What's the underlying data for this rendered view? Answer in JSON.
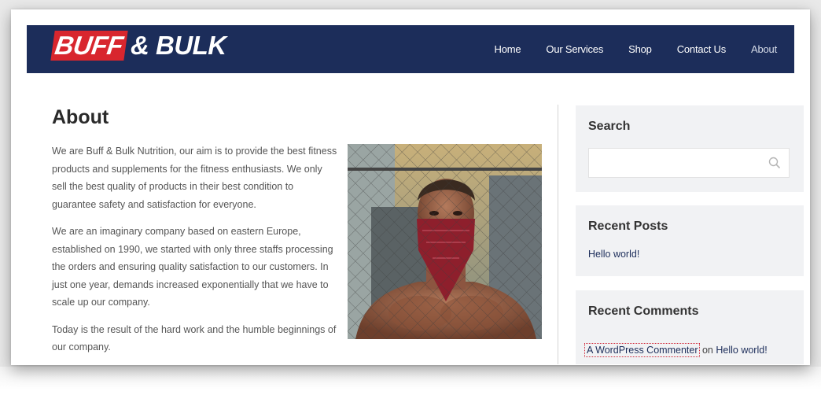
{
  "header": {
    "logo": {
      "part1": "BUFF",
      "part2": "& BULK"
    },
    "nav": [
      "Home",
      "Our Services",
      "Shop",
      "Contact Us",
      "About"
    ]
  },
  "main": {
    "title": "About",
    "paragraphs": [
      "We are Buff & Bulk Nutrition, our aim is to provide the best fitness products and supplements for the fitness enthusiasts. We only sell the best quality of products in their best condition to guarantee safety and satisfaction for everyone.",
      "We are an imaginary company based on eastern Europe, established on 1990, we started with only three staffs processing the orders and ensuring quality satisfaction to our customers. In just one year, demands increased exponentially that we have to scale up our company.",
      "Today is the result of the hard work and the humble beginnings of our company."
    ]
  },
  "sidebar": {
    "search": {
      "title": "Search",
      "value": ""
    },
    "recent_posts": {
      "title": "Recent Posts",
      "items": [
        "Hello world!"
      ]
    },
    "recent_comments": {
      "title": "Recent Comments",
      "author": "A WordPress Commenter",
      "connector": "on",
      "post": "Hello world!"
    }
  },
  "colors": {
    "header_bg": "#1c2d5a",
    "logo_red": "#d8262e",
    "widget_bg": "#f1f2f4",
    "link": "#1c2d5a"
  }
}
